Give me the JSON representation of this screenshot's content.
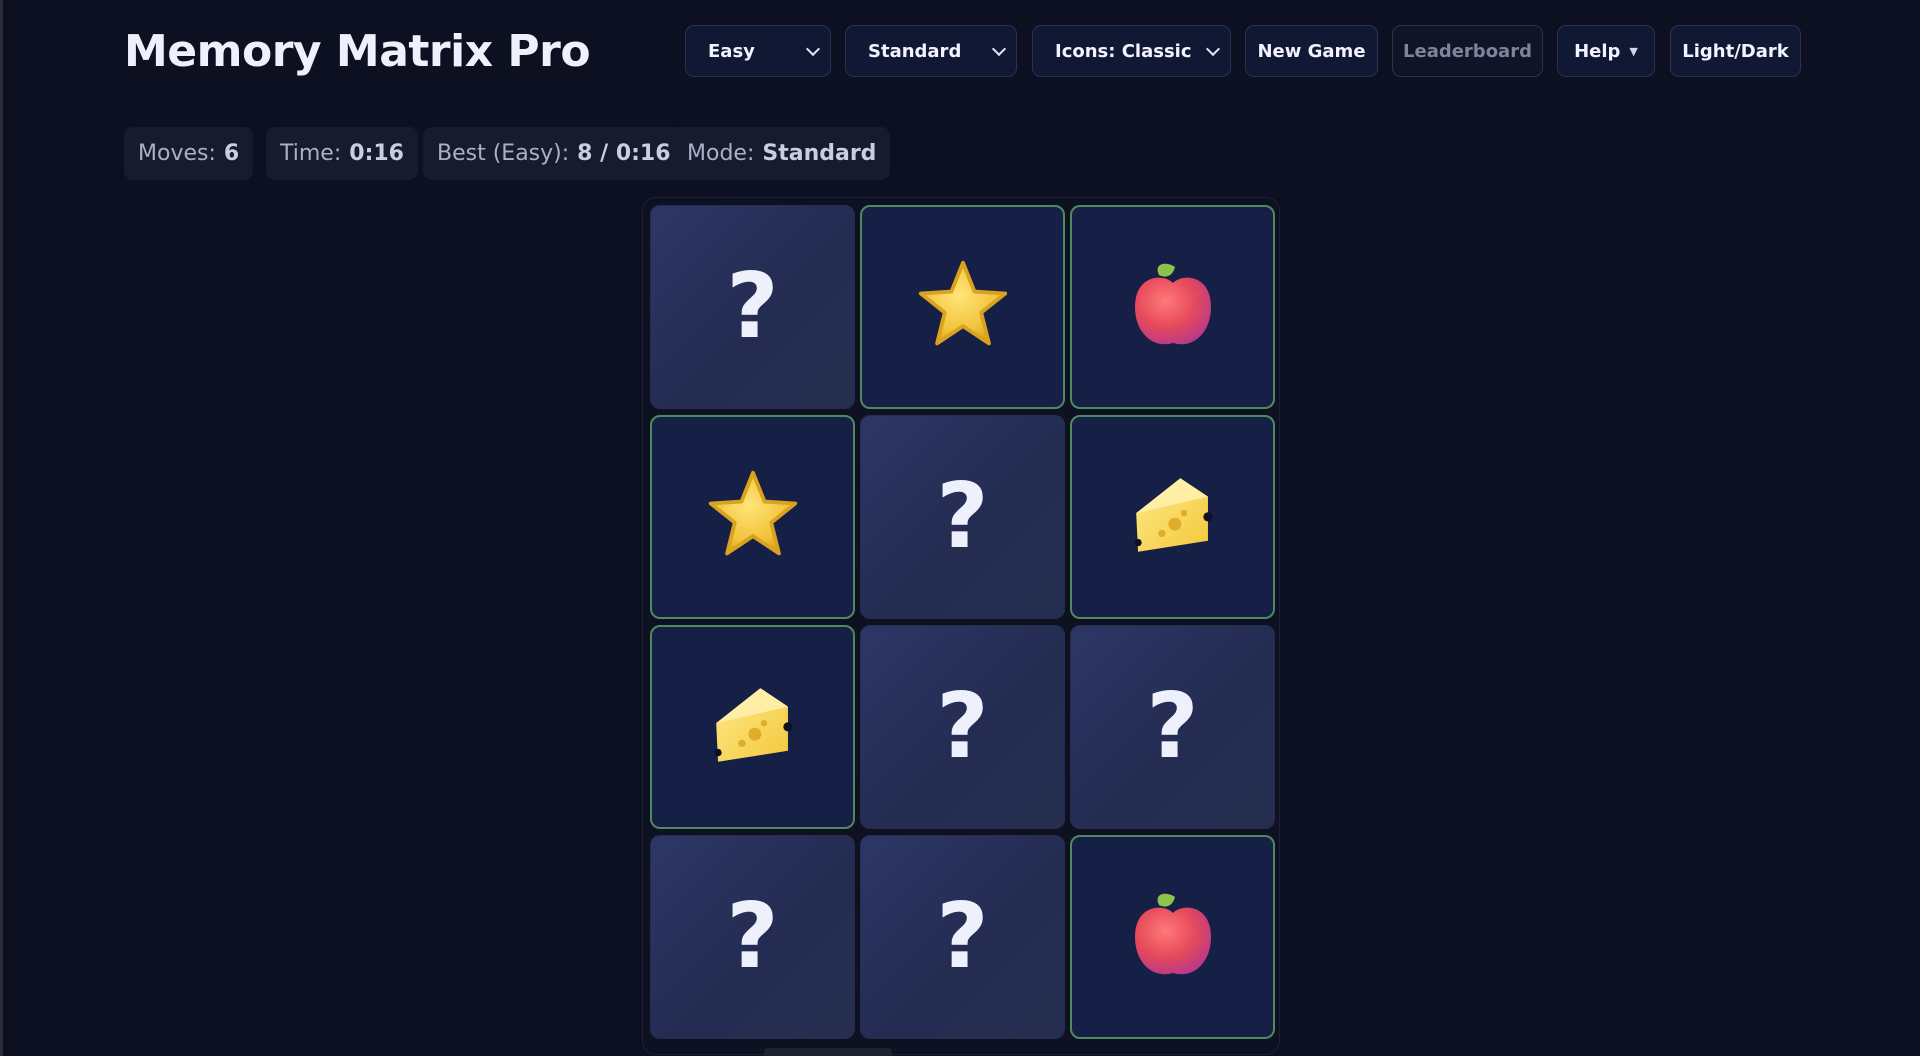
{
  "app": {
    "title": "Memory Matrix Pro"
  },
  "controls": {
    "difficulty": "Easy",
    "mode": "Standard",
    "icon_set": "Icons: Classic",
    "new_game": "New Game",
    "leaderboard": "Leaderboard",
    "help": "Help",
    "theme": "Light/Dark"
  },
  "stats": {
    "moves_label": "Moves:",
    "moves_value": "6",
    "time_label": "Time:",
    "time_value": "0:16",
    "best_label": "Best (Easy):",
    "best_value": "8 / 0:16",
    "mode_label": "Mode:",
    "mode_value": "Standard"
  },
  "board": {
    "rows": 4,
    "cols": 3,
    "hidden_symbol": "?",
    "cards": [
      {
        "state": "hidden"
      },
      {
        "state": "matched",
        "icon": "star-icon"
      },
      {
        "state": "matched",
        "icon": "apple-icon"
      },
      {
        "state": "matched",
        "icon": "star-icon"
      },
      {
        "state": "hidden"
      },
      {
        "state": "matched",
        "icon": "cheese-icon"
      },
      {
        "state": "matched",
        "icon": "cheese-icon"
      },
      {
        "state": "hidden"
      },
      {
        "state": "hidden"
      },
      {
        "state": "hidden"
      },
      {
        "state": "hidden"
      },
      {
        "state": "matched",
        "icon": "apple-icon"
      }
    ]
  },
  "colors": {
    "background": "#0c1020",
    "matched_border": "#4f8a5e",
    "hidden_card": "#2d3766",
    "matched_card": "#161f45"
  }
}
